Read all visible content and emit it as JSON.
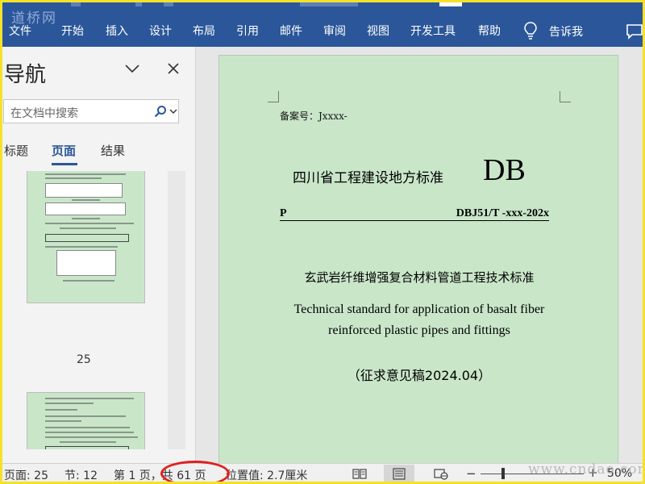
{
  "watermarks": {
    "top_left": "道桥网",
    "bottom_right": "www.cndao.com"
  },
  "ribbon": {
    "menu": [
      {
        "label": "文件"
      },
      {
        "label": "开始"
      },
      {
        "label": "插入"
      },
      {
        "label": "设计"
      },
      {
        "label": "布局"
      },
      {
        "label": "引用"
      },
      {
        "label": "邮件"
      },
      {
        "label": "审阅"
      },
      {
        "label": "视图"
      },
      {
        "label": "开发工具"
      },
      {
        "label": "帮助"
      }
    ],
    "tell_me": "告诉我",
    "accent": "#2b579a"
  },
  "nav": {
    "title": "导航",
    "search_placeholder": "在文档中搜索",
    "tabs": [
      {
        "label": "标题"
      },
      {
        "label": "页面"
      },
      {
        "label": "结果"
      }
    ],
    "active_tab": "页面",
    "thumbnail_page": "25"
  },
  "document": {
    "filing": "备案号：Jxxxx-",
    "standard_title": "四川省工程建设地方标准",
    "db": "DB",
    "p_label": "P",
    "code": "DBJ51/T -xxx-202x",
    "cn_title": "玄武岩纤维增强复合材料管道工程技术标准",
    "en_title_line1": "Technical standard for application of basalt fiber",
    "en_title_line2": "reinforced plastic pipes and fittings",
    "draft": "（征求意见稿2024.04）"
  },
  "status": {
    "page": "页面: 25",
    "section": "节: 12",
    "page_of": "第 1 页，共 61 页",
    "position": "位置值: 2.7厘米",
    "zoom": "50%"
  }
}
